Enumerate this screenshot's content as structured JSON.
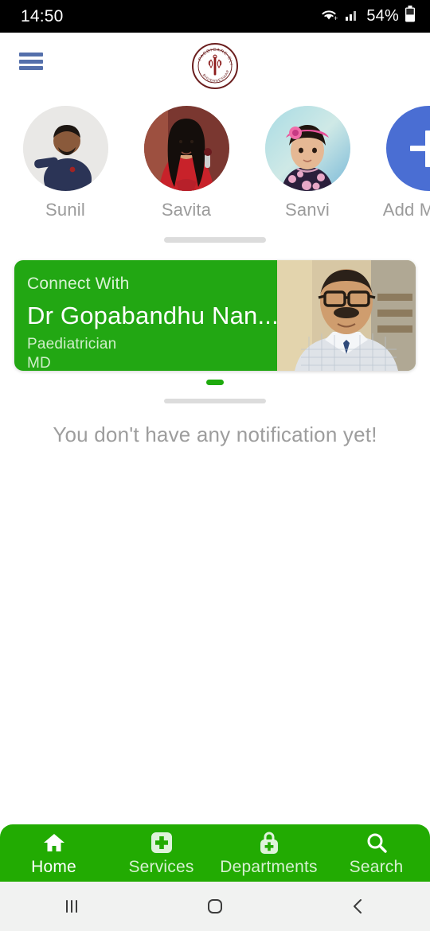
{
  "status_bar": {
    "time": "14:50",
    "battery_percent": "54%",
    "wifi_icon": "wifi-icon",
    "signal_icon": "cellular-signal-icon",
    "battery_icon": "battery-icon"
  },
  "header": {
    "menu_icon": "hamburger-menu-icon",
    "menu_color": "#546fab",
    "logo_icon": "paedicare-clinic-logo",
    "logo_text_top": "PAEDICARE CLINIC",
    "logo_text_bottom": "BHUBANESWAR"
  },
  "members": {
    "items": [
      {
        "name": "Sunil",
        "avatar_icon": "avatar-photo-sunil"
      },
      {
        "name": "Savita",
        "avatar_icon": "avatar-photo-savita"
      },
      {
        "name": "Sanvi",
        "avatar_icon": "avatar-photo-sanvi"
      }
    ],
    "add_member": {
      "label": "Add Mem...",
      "icon": "plus-icon",
      "color": "#4a6ed3"
    }
  },
  "doctor_card": {
    "connect_label": "Connect With",
    "name": "Dr Gopabandhu Nan...",
    "speciality": "Paediatrician",
    "degree": "MD",
    "photo_icon": "doctor-portrait-photo",
    "background_color": "#22a713"
  },
  "carousel": {
    "indicator_color": "#1eaa0d",
    "track_color": "#dcdcdc"
  },
  "notifications": {
    "empty_text": "You don't have any notification yet!"
  },
  "bottom_nav": {
    "background_color": "#22ab02",
    "items": [
      {
        "label": "Home",
        "icon": "home-icon",
        "active": true
      },
      {
        "label": "Services",
        "icon": "medical-cross-icon",
        "active": false
      },
      {
        "label": "Departments",
        "icon": "medical-bag-icon",
        "active": false
      },
      {
        "label": "Search",
        "icon": "search-icon",
        "active": false
      }
    ]
  },
  "system_nav": {
    "recents_icon": "recents-icon",
    "home_icon": "home-square-icon",
    "back_icon": "back-chevron-icon"
  }
}
